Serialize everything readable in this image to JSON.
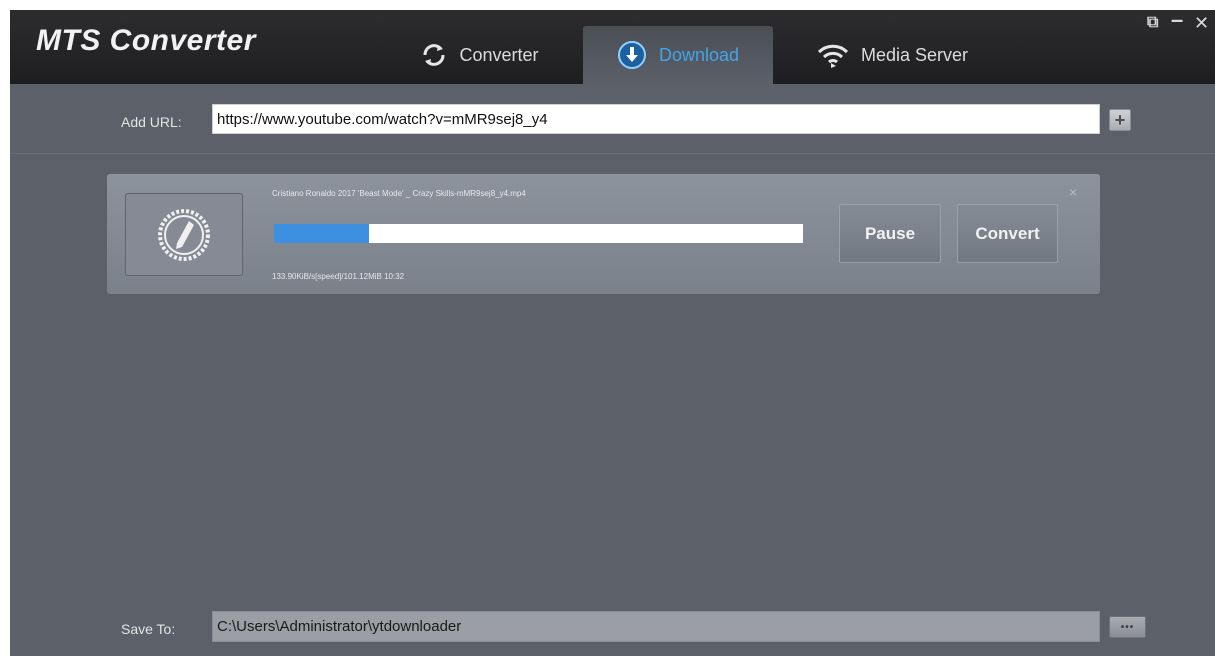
{
  "app": {
    "title": "MTS Converter"
  },
  "tabs": [
    {
      "label": "Converter",
      "icon": "refresh-icon",
      "active": false
    },
    {
      "label": "Download",
      "icon": "download-icon",
      "active": true
    },
    {
      "label": "Media Server",
      "icon": "wifi-icon",
      "active": false
    }
  ],
  "window_controls": {
    "restore": "⧉",
    "minimize": "–",
    "close": "✕"
  },
  "url": {
    "label": "Add URL:",
    "value": "https://www.youtube.com/watch?v=mMR9sej8_y4",
    "add_button": "+"
  },
  "download": {
    "filename": "Cristiano Ronaldo 2017  'Beast Mode' _ Crazy Skills-mMR9sej8_y4.mp4",
    "progress": 0.18,
    "status": "133.90KiB/s[speed]/101.12MiB 10:32",
    "pause_label": "Pause",
    "convert_label": "Convert",
    "close_label": "×"
  },
  "save": {
    "label": "Save To:",
    "value": "C:\\Users\\Administrator\\ytdownloader",
    "browse_label": "•••"
  },
  "colors": {
    "accent": "#3fa6ec",
    "progress": "#3d8fe0",
    "background": "#5c6069",
    "titlebar": "#1e1e20"
  }
}
